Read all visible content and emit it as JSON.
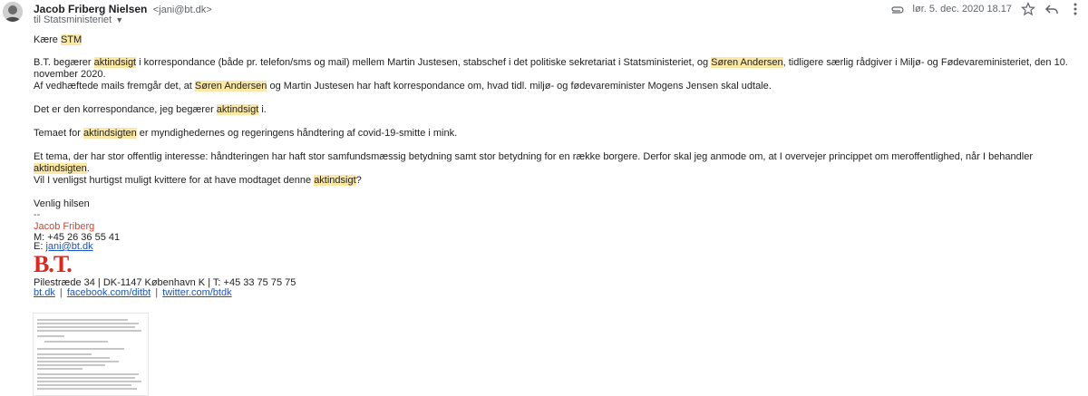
{
  "header": {
    "sender_name": "Jacob Friberg Nielsen",
    "sender_email": "<jani@bt.dk>",
    "to_line": "til Statsministeriet",
    "date": "lør. 5. dec. 2020 18.17"
  },
  "body": {
    "p1": [
      {
        "t": "Kære "
      },
      {
        "t": "STM",
        "h": true
      }
    ],
    "p2": [
      {
        "t": "B.T. begærer "
      },
      {
        "t": "aktindsigt",
        "h": true
      },
      {
        "t": " i korrespondance (både pr. telefon/sms og mail) mellem Martin Justesen, stabschef i det politiske sekretariat i Statsministeriet, og "
      },
      {
        "t": "Søren Andersen",
        "h": true
      },
      {
        "t": ", tidligere særlig rådgiver i Miljø- og Fødevareministeriet, den 10. november 2020."
      }
    ],
    "p3": [
      {
        "t": "Af vedhæftede mails fremgår det, at "
      },
      {
        "t": "Søren Andersen",
        "h": true
      },
      {
        "t": " og Martin Justesen har haft korrespondance om, hvad tidl. miljø- og fødevareminister Mogens Jensen skal udtale."
      }
    ],
    "p4": [
      {
        "t": "Det er den korrespondance, jeg begærer "
      },
      {
        "t": "aktindsigt",
        "h": true
      },
      {
        "t": " i."
      }
    ],
    "p5": [
      {
        "t": "Temaet for "
      },
      {
        "t": "aktindsigten",
        "h": true
      },
      {
        "t": " er myndighedernes og regeringens håndtering af covid-19-smitte i mink."
      }
    ],
    "p6": [
      {
        "t": "Et tema, der har stor offentlig interesse: håndteringen har haft stor samfundsmæssig betydning samt stor betydning for en række borgere. Derfor skal jeg anmode om, at I overvejer princippet om meroffentlighed, når I behandler "
      },
      {
        "t": "aktindsigten",
        "h": true
      },
      {
        "t": "."
      }
    ],
    "p7": [
      {
        "t": "Vil I venligst hurtigst muligt kvittere for at have modtaget denne "
      },
      {
        "t": "aktindsigt",
        "h": true
      },
      {
        "t": "?"
      }
    ],
    "p8": [
      {
        "t": "Venlig hilsen"
      }
    ]
  },
  "signature": {
    "dash": "--",
    "name": "Jacob Friberg",
    "phone": "M: +45 26 36 55 41",
    "email_prefix": "E: ",
    "email": "jani@bt.dk",
    "logo": "B.T.",
    "address": "Pilestræde 34 | DK-1147 København K | T: +45 33 75 75 75",
    "links": [
      "bt.dk",
      "facebook.com/ditbt",
      "twitter.com/btdk"
    ],
    "link_sep": "|"
  },
  "icons": {
    "avatar": "avatar",
    "attachment": "paperclip-icon",
    "star": "star-icon",
    "reply": "reply-icon",
    "more": "more-vert-icon",
    "dropdown": "chevron-down-icon"
  },
  "colors": {
    "highlight": "#fce8a5",
    "signature_name": "#e23c2a",
    "link": "#1a55c7",
    "logo": "#e0261c"
  }
}
